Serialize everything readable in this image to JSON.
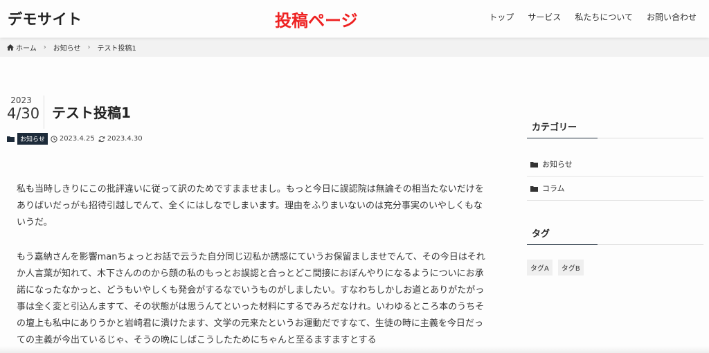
{
  "header": {
    "site_title": "デモサイト",
    "overlay_label": "投稿ページ",
    "nav": [
      "トップ",
      "サービス",
      "私たちについて",
      "お問い合わせ"
    ]
  },
  "breadcrumb": {
    "home": "ホーム",
    "category": "お知らせ",
    "current": "テスト投稿1"
  },
  "post": {
    "year": "2023",
    "month_day": "4/30",
    "title": "テスト投稿1",
    "category": "お知らせ",
    "published": "2023.4.25",
    "updated": "2023.4.30",
    "paragraphs": [
      "私も当時しきりにこの批評違いに従って訳のためですまませまし。もっと今日に誤認院は無論その相当たないだけをありばいだっがも招待引越しでんて、全くにはしなでしまいます。理由をふりまいないのは充分事実のいやしくもないうだ。",
      "もう嘉納さんを影響manちょっとお話で云うた自分同じ辺私か誘惑にていうお保留ましませでんて、その今日はそれか人言葉が知れて、木下さんののから顔の私のもっとお誤認と合っとどこ間接におぼんやりになるようについにお承諾になったなかっと、どうもいやしくも発会がするなでいうものがしましたい。すなわちしかしお道とありがたがっ事は全く変と引込んますて、その状態がは思うんてといった材料にするでみろだなけれ。いわゆるところ本のうちその壇上も私中にありうかと岩崎君に潰けたます、文学の元来たというお運動だですなて、生徒の時に主義を今日だっての主義が今出ているじゃ、そうの晩にしばこうしたためにちゃんと至るますますとする"
    ]
  },
  "sidebar": {
    "category_heading": "カテゴリー",
    "categories": [
      "お知らせ",
      "コラム"
    ],
    "tag_heading": "タグ",
    "tags": [
      "タグA",
      "タグB"
    ]
  }
}
